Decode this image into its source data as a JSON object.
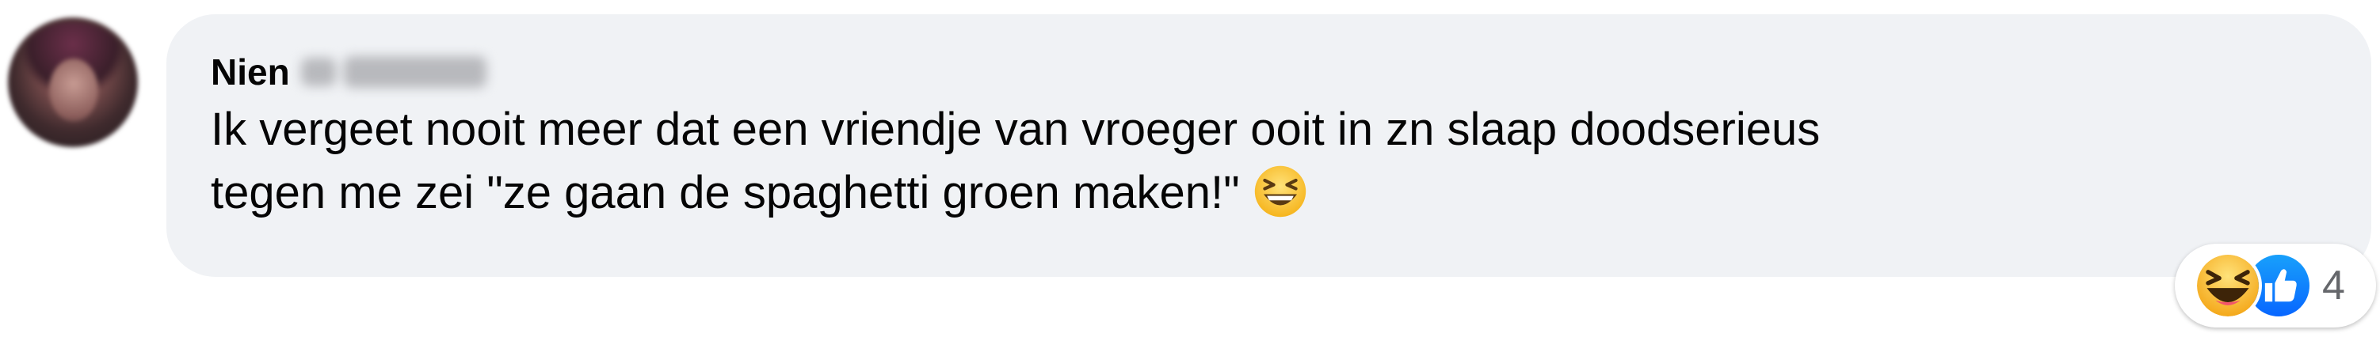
{
  "comment": {
    "author": "Nien",
    "text": "Ik vergeet nooit meer dat een vriendje van vroeger ooit in zn slaap doodserieus\ntegen me zei \"ze gaan de spaghetti groen maken!\"",
    "inline_emoji": "laughing-emoji"
  },
  "reactions": {
    "icons": [
      "haha-reaction-icon",
      "like-reaction-icon"
    ],
    "count": "4"
  },
  "colors": {
    "bubble_background": "#f0f2f5",
    "text": "#050505",
    "secondary_text": "#65676b",
    "like_blue": "#0866ff",
    "emoji_yellow": "#fcd34d"
  }
}
